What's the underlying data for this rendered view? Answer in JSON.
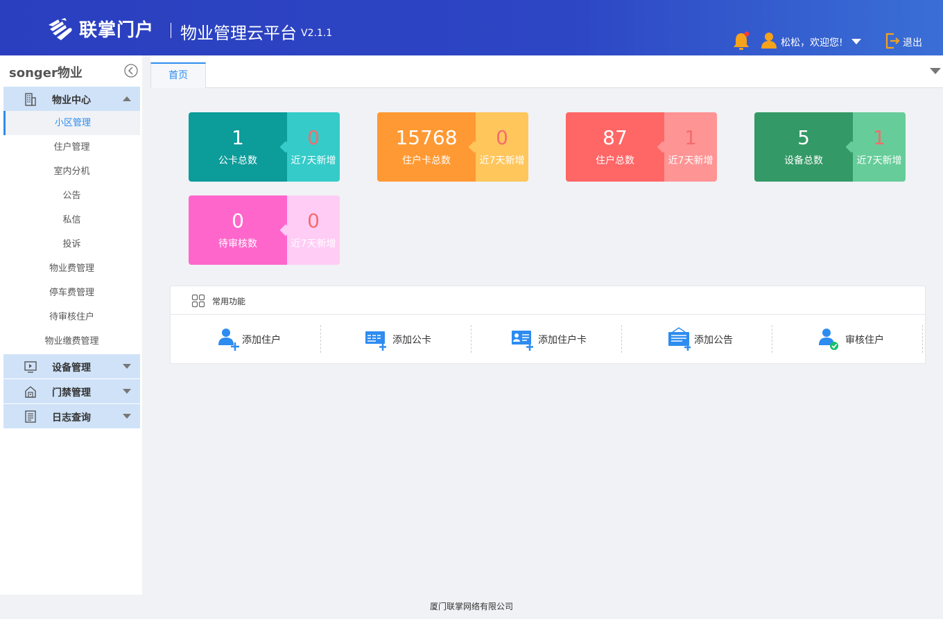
{
  "header": {
    "logo_text": "联掌门户",
    "platform_title": "物业管理云平台",
    "version": "V2.1.1",
    "greeting": "松松，欢迎您!",
    "logout_label": "退出"
  },
  "sidebar": {
    "brand": "songer物业",
    "groups": [
      {
        "label": "物业中心",
        "icon": "building-icon",
        "expanded": true
      },
      {
        "label": "设备管理",
        "icon": "device-icon",
        "expanded": false
      },
      {
        "label": "门禁管理",
        "icon": "access-control-icon",
        "expanded": false
      },
      {
        "label": "日志查询",
        "icon": "log-icon",
        "expanded": false
      }
    ],
    "items": [
      {
        "label": "小区管理",
        "active": true
      },
      {
        "label": "住户管理"
      },
      {
        "label": "室内分机"
      },
      {
        "label": "公告"
      },
      {
        "label": "私信"
      },
      {
        "label": "投诉"
      },
      {
        "label": "物业费管理"
      },
      {
        "label": "停车费管理"
      },
      {
        "label": "待审核住户"
      },
      {
        "label": "物业缴费管理"
      }
    ]
  },
  "tabs": [
    {
      "label": "首页",
      "active": true
    }
  ],
  "stats": [
    {
      "value": "1",
      "label": "公卡总数",
      "recent": "0",
      "recent_label": "近7天新增",
      "main_color": "#0c9c9a",
      "side_color": "#35cbc9"
    },
    {
      "value": "15768",
      "label": "住户卡总数",
      "recent": "0",
      "recent_label": "近7天新增",
      "main_color": "#ff9933",
      "side_color": "#ffc65c"
    },
    {
      "value": "87",
      "label": "住户总数",
      "recent": "1",
      "recent_label": "近7天新增",
      "main_color": "#ff6666",
      "side_color": "#ff9494"
    },
    {
      "value": "5",
      "label": "设备总数",
      "recent": "1",
      "recent_label": "近7天新增",
      "main_color": "#339966",
      "side_color": "#66cc99"
    },
    {
      "value": "0",
      "label": "待审核数",
      "recent": "0",
      "recent_label": "近7天新增",
      "main_color": "#ff66cc",
      "side_color": "#ffccf5"
    }
  ],
  "functions": {
    "title": "常用功能",
    "items": [
      {
        "label": "添加住户",
        "icon": "add-resident-icon"
      },
      {
        "label": "添加公卡",
        "icon": "add-public-card-icon"
      },
      {
        "label": "添加住户卡",
        "icon": "add-resident-card-icon"
      },
      {
        "label": "添加公告",
        "icon": "add-notice-icon"
      },
      {
        "label": "审核住户",
        "icon": "review-resident-icon"
      }
    ]
  },
  "footer": {
    "company": "厦门联掌网络有限公司"
  },
  "colors": {
    "header_start": "#2a3fbf",
    "header_end": "#3a6fd6",
    "accent": "#2d8cf0",
    "icon_blue": "#2d8cf0",
    "icon_orange": "#f7a21b"
  }
}
